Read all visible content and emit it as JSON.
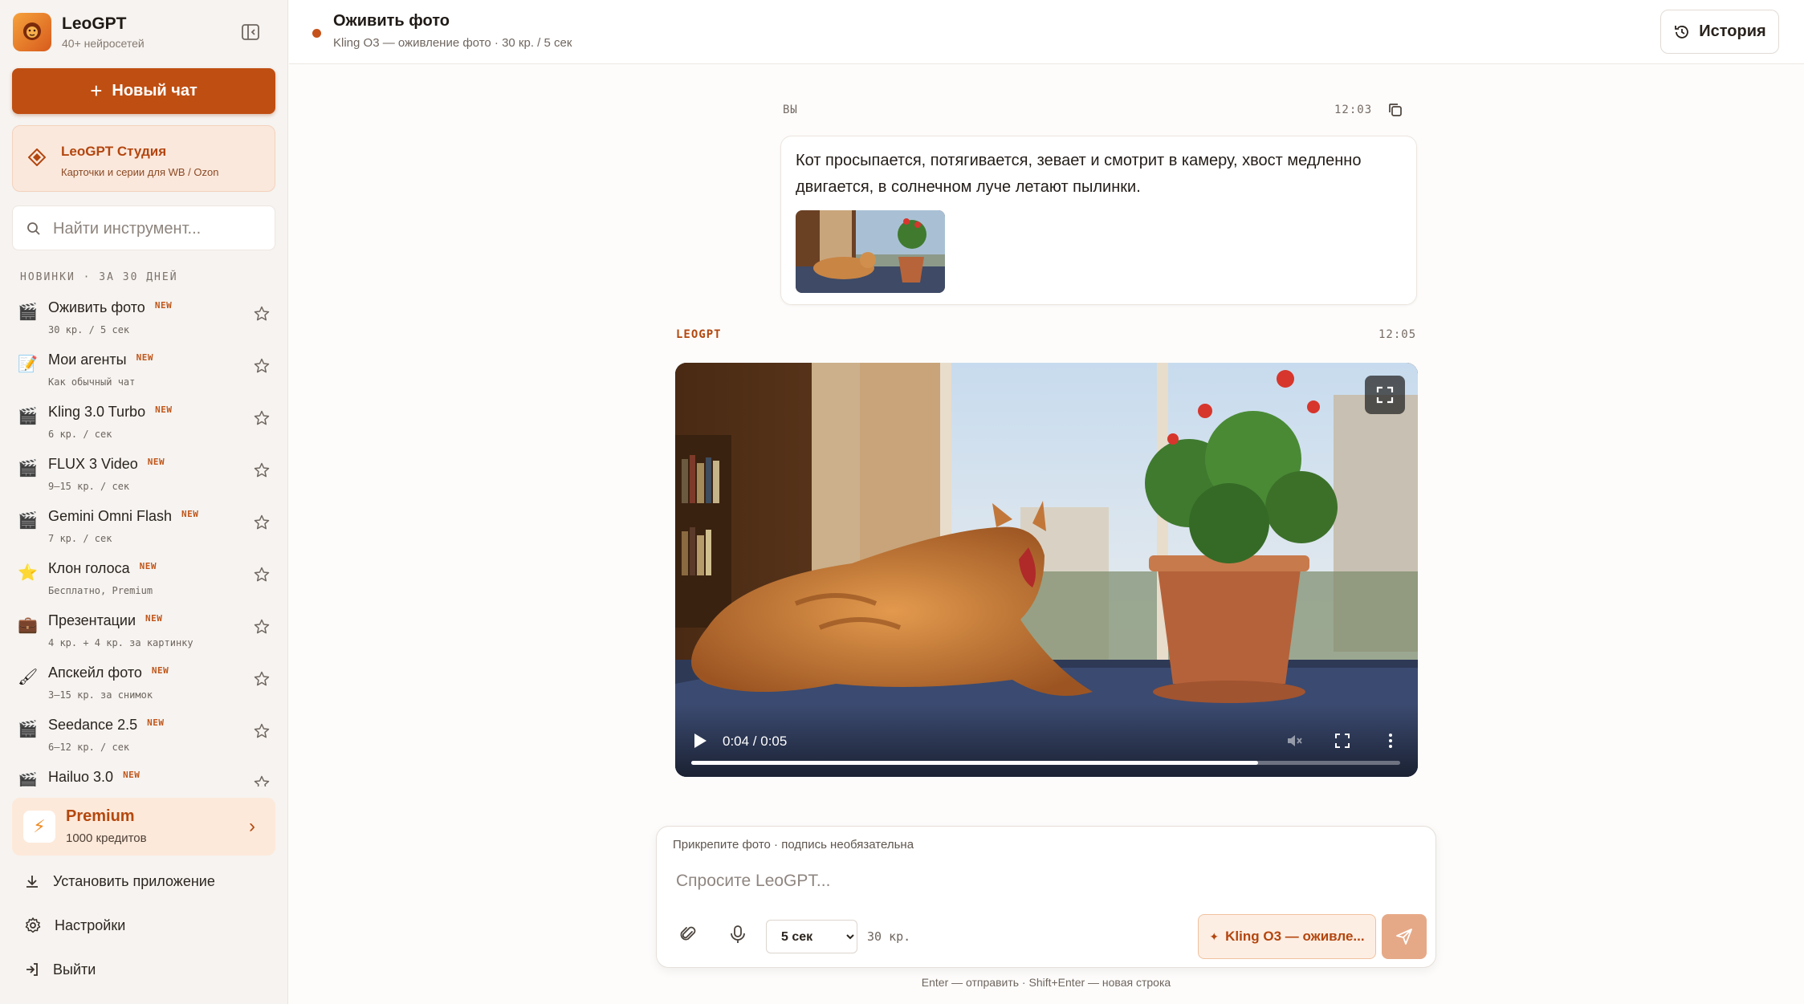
{
  "sidebar": {
    "brand_name": "LeoGPT",
    "brand_sub": "40+ нейросетей",
    "new_chat_label": "Новый чат",
    "studio": {
      "title": "LeoGPT Студия",
      "subtitle": "Карточки и серии для WB / Ozon"
    },
    "search_placeholder": "Найти инструмент...",
    "section_label": "НОВИНКИ · ЗА 30 ДНЕЙ",
    "tools": [
      {
        "name": "Оживить фото",
        "badge": "NEW",
        "sub": "30 кр. / 5 сек",
        "icon": "clapper-icon"
      },
      {
        "name": "Мои агенты",
        "badge": "NEW",
        "sub": "Как обычный чат",
        "icon": "notepad-icon"
      },
      {
        "name": "Kling 3.0 Turbo",
        "badge": "NEW",
        "sub": "6 кр. / сек",
        "icon": "clapper-icon"
      },
      {
        "name": "FLUX 3 Video",
        "badge": "NEW",
        "sub": "9–15 кр. / сек",
        "icon": "clapper-icon"
      },
      {
        "name": "Gemini Omni Flash",
        "badge": "NEW",
        "sub": "7 кр. / сек",
        "icon": "clapper-icon"
      },
      {
        "name": "Клон голоса",
        "badge": "NEW",
        "sub": "Бесплатно, Premium",
        "icon": "star-icon"
      },
      {
        "name": "Презентации",
        "badge": "NEW",
        "sub": "4 кр. + 4 кр. за картинку",
        "icon": "briefcase-icon"
      },
      {
        "name": "Апскейл фото",
        "badge": "NEW",
        "sub": "3–15 кр. за снимок",
        "icon": "brush-icon"
      },
      {
        "name": "Seedance 2.5",
        "badge": "NEW",
        "sub": "6–12 кр. / сек",
        "icon": "clapper-icon"
      },
      {
        "name": "Hailuo 3.0",
        "badge": "NEW",
        "sub": "",
        "icon": "clapper-icon"
      }
    ],
    "premium": {
      "title": "Premium",
      "subtitle": "1000 кредитов"
    },
    "links": {
      "install": "Установить приложение",
      "settings": "Настройки",
      "logout": "Выйти"
    }
  },
  "header": {
    "title": "Оживить фото",
    "subtitle": "Kling O3 — оживление фото · 30 кр. / 5 сек",
    "history_label": "История",
    "status_color": "#c5521a"
  },
  "chat": {
    "user": {
      "author": "ВЫ",
      "time": "12:03",
      "text": "Кот просыпается, потягивается, зевает и смотрит в камеру, хвост медленно двигается, в солнечном луче летают пылинки."
    },
    "bot": {
      "author": "LEOGPT",
      "time": "12:05",
      "video": {
        "time_display": "0:04 / 0:05",
        "progress": 0.8
      }
    }
  },
  "composer": {
    "hint": "Прикрепите фото · подпись необязательна",
    "placeholder": "Спросите LeoGPT...",
    "duration_options": [
      "5 сек"
    ],
    "duration_selected": "5 сек",
    "cost": "30 кр.",
    "model_label": "Kling O3 — оживле...",
    "footer_hint": "Enter — отправить · Shift+Enter — новая строка"
  },
  "colors": {
    "accent": "#bf4e12",
    "accent_light": "#fde9da",
    "send_disabled": "#e6a987"
  }
}
